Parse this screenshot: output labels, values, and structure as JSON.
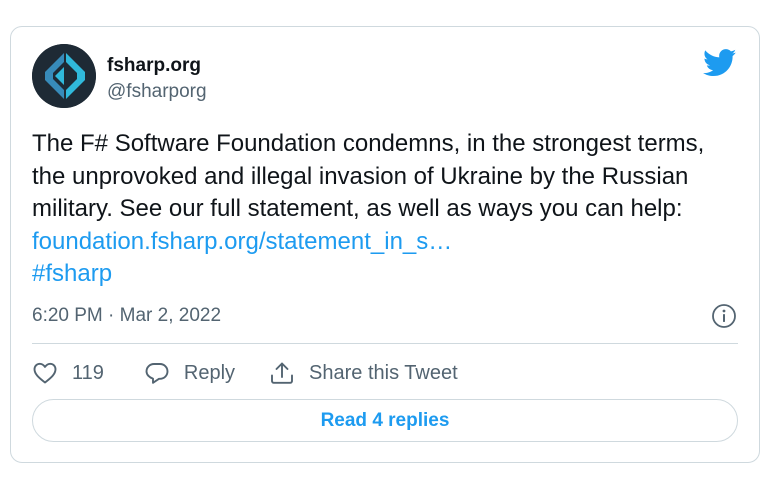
{
  "account": {
    "display_name": "fsharp.org",
    "handle": "@fsharporg",
    "avatar_icon": "fsharp-logo-icon"
  },
  "tweet": {
    "text": "The F# Software Foundation condemns, in the strongest terms, the unprovoked and illegal invasion of Ukraine by the Russian military. See our full statement, as well as ways you can help: ",
    "link": "foundation.fsharp.org/statement_in_s…",
    "hashtag": "#fsharp",
    "timestamp": "6:20 PM · Mar 2, 2022"
  },
  "actions": {
    "like_count": "119",
    "reply_label": "Reply",
    "share_label": "Share this Tweet"
  },
  "footer": {
    "read_replies_label": "Read 4 replies"
  },
  "colors": {
    "accent": "#1d9bf0",
    "text": "#0f1419",
    "muted": "#536471",
    "border": "#cfd9de"
  },
  "icons": [
    "fsharp-logo-icon",
    "twitter-bird-icon",
    "info-icon",
    "heart-icon",
    "reply-bubble-icon",
    "share-icon"
  ]
}
